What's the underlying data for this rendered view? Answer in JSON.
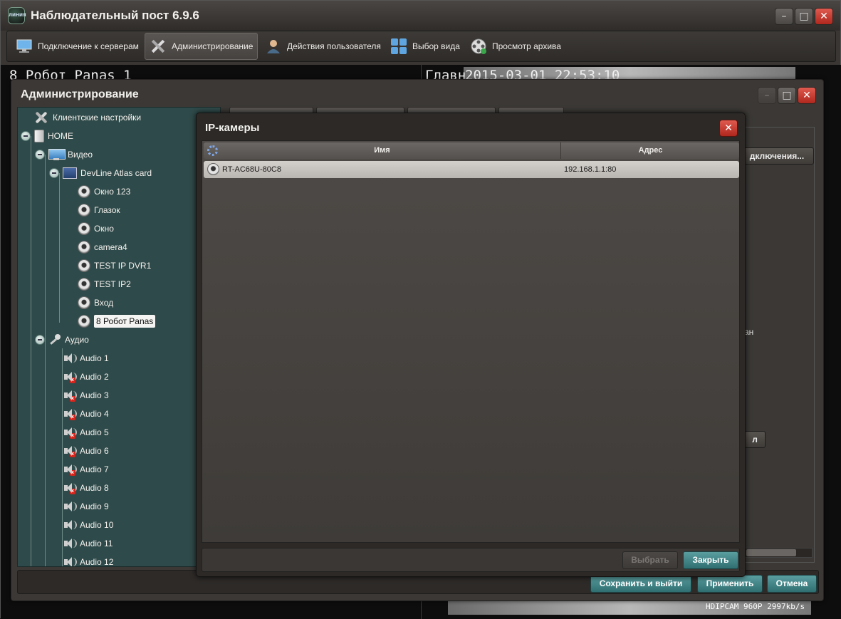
{
  "app": {
    "title": "Наблюдательный пост 6.9.6",
    "logo_text": "ЛИНИЯ"
  },
  "toolbar": {
    "items": [
      {
        "label": "Подключение к серверам",
        "icon": "monitor-connect-icon"
      },
      {
        "label": "Администрирование",
        "icon": "tools-icon"
      },
      {
        "label": "Действия пользователя",
        "icon": "user-icon"
      },
      {
        "label": "Выбор вида",
        "icon": "layout-grid-icon"
      },
      {
        "label": "Просмотр архива",
        "icon": "film-reel-icon"
      }
    ]
  },
  "video": {
    "left_label": "8 Робот Panas 1",
    "right_label": "Главн",
    "timestamp": "2015-03-01 22:53:10",
    "bottom_overlay": "HDIPCAM 960P 2997kb/s"
  },
  "admin": {
    "title": "Администрирование",
    "tree": {
      "client_settings": "Клиентские настройки",
      "home": "HOME",
      "video": "Видео",
      "card": "DevLine Atlas card",
      "cameras": [
        "Окно 123",
        "Глазок",
        "Окно",
        "camera4",
        "TEST IP DVR1",
        "TEST IP2",
        "Вход",
        "8 Робот Panas"
      ],
      "audio": "Аудио",
      "audio_channels": [
        {
          "label": "Audio 1",
          "muted": false
        },
        {
          "label": "Audio 2",
          "muted": true
        },
        {
          "label": "Audio 3",
          "muted": true
        },
        {
          "label": "Audio 4",
          "muted": true
        },
        {
          "label": "Audio 5",
          "muted": true
        },
        {
          "label": "Audio 6",
          "muted": true
        },
        {
          "label": "Audio 7",
          "muted": true
        },
        {
          "label": "Audio 8",
          "muted": true
        },
        {
          "label": "Audio 9",
          "muted": false
        },
        {
          "label": "Audio 10",
          "muted": false
        },
        {
          "label": "Audio 11",
          "muted": false
        },
        {
          "label": "Audio 12",
          "muted": false
        }
      ],
      "selected_camera": "8 Робот Panas"
    },
    "right_fragments": {
      "connection_button": "дключения...",
      "text_fragment": "ан",
      "small_button": "л"
    },
    "buttons": {
      "save_exit": "Сохранить и выйти",
      "apply": "Применить",
      "cancel": "Отмена"
    }
  },
  "ip_dialog": {
    "title": "IP-камеры",
    "columns": {
      "name": "Имя",
      "address": "Адрес"
    },
    "rows": [
      {
        "name": "RT-AC68U-80C8",
        "address": "192.168.1.1:80"
      }
    ],
    "buttons": {
      "select": "Выбрать",
      "close": "Закрыть"
    }
  },
  "colors": {
    "tree_bg": "#2f4a4a",
    "accent_button": "#3f8487",
    "close_red": "#c8352b"
  }
}
